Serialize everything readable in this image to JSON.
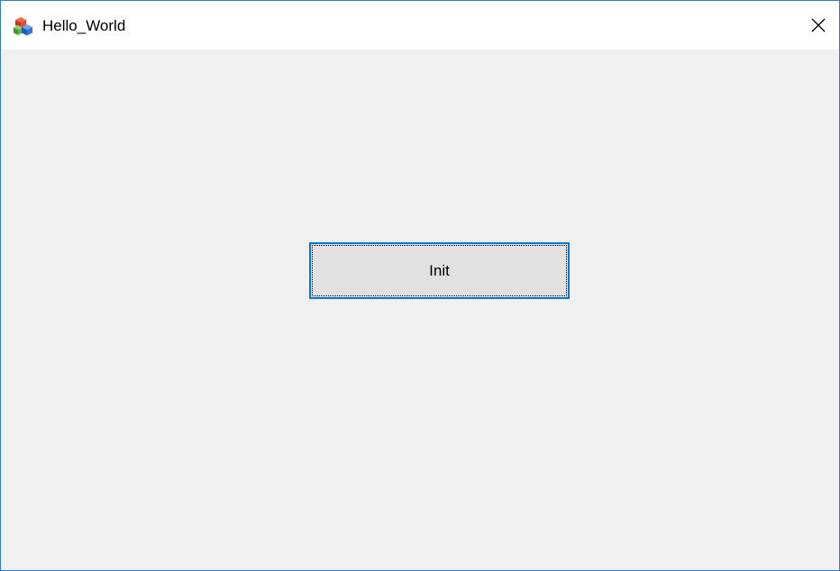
{
  "window": {
    "title": "Hello_World",
    "app_icon": "app-cubes-icon",
    "close_icon": "close-icon",
    "border_color": "#2b7bd3"
  },
  "main": {
    "init_button_label": "Init",
    "button_focus_color": "#0078d7",
    "background_color": "#f0f0f0"
  }
}
